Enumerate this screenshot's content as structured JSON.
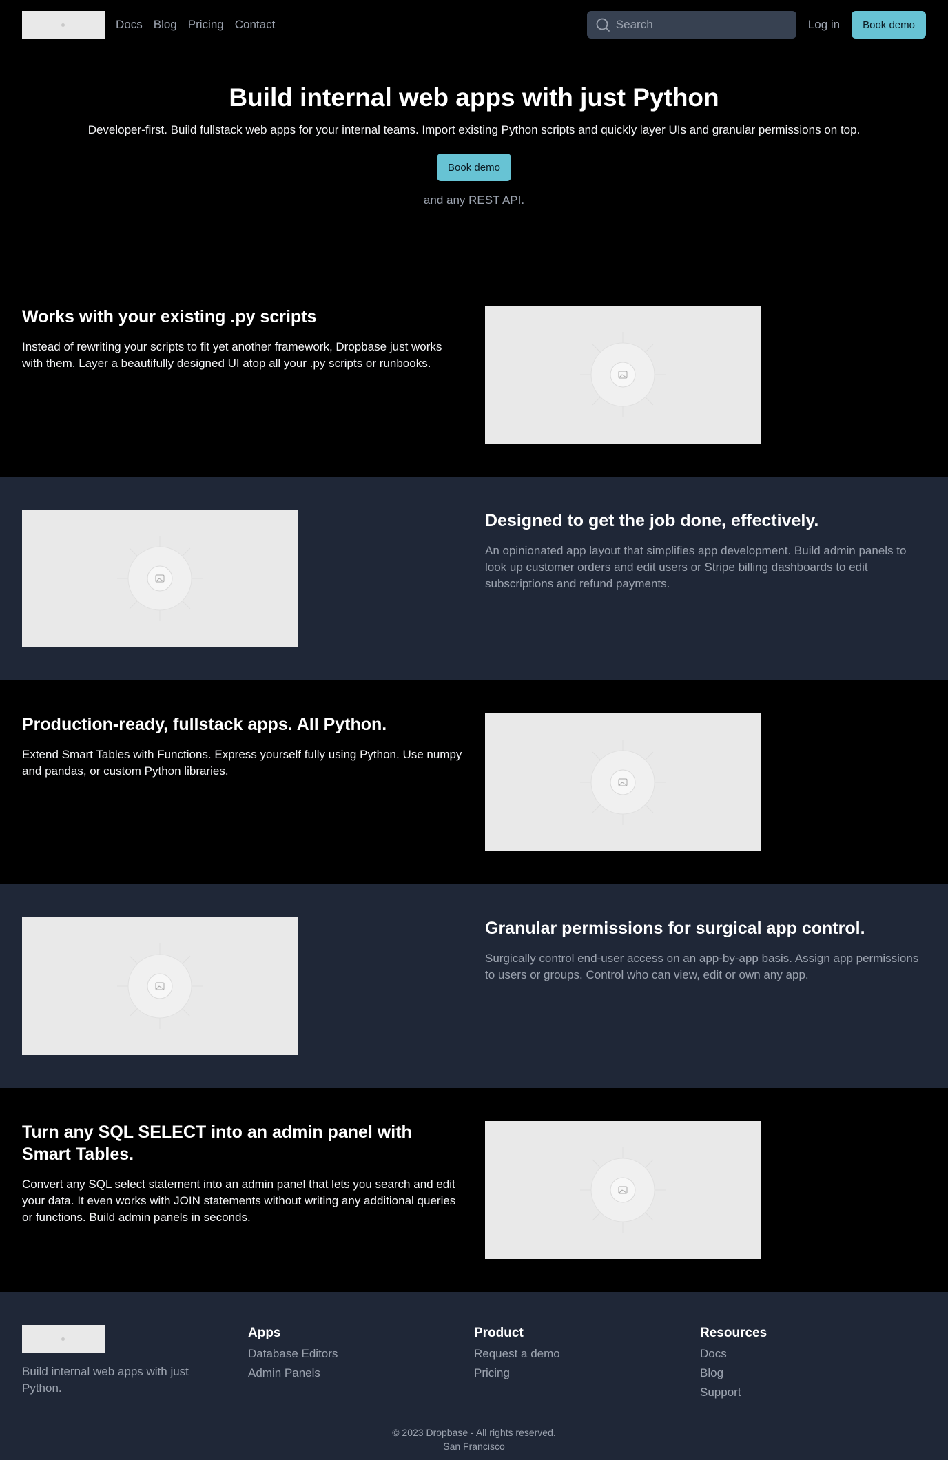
{
  "header": {
    "nav": [
      "Docs",
      "Blog",
      "Pricing",
      "Contact"
    ],
    "search_placeholder": "Search",
    "login_label": "Log in",
    "demo_label": "Book demo"
  },
  "hero": {
    "title": "Build internal web apps with just Python",
    "subtitle": "Developer-first. Build fullstack web apps for your internal teams. Import existing Python scripts and quickly layer UIs and granular permissions on top.",
    "cta": "Book demo",
    "note": "and any REST API."
  },
  "features": [
    {
      "title": "Works with your existing .py scripts",
      "body": "Instead of rewriting your scripts to fit yet another framework, Dropbase just works with them. Layer a beautifully designed UI atop all your .py scripts or runbooks."
    },
    {
      "title": "Designed to get the job done, effectively.",
      "body": "An opinionated app layout that simplifies app development. Build admin panels to look up customer orders and edit users or Stripe billing dashboards to edit subscriptions and refund payments."
    },
    {
      "title": "Production-ready, fullstack apps. All Python.",
      "body": "Extend Smart Tables with Functions. Express yourself fully using Python. Use numpy and pandas, or custom Python libraries."
    },
    {
      "title": "Granular permissions for surgical app control.",
      "body": "Surgically control end-user access on an app-by-app basis. Assign app permissions to users or groups. Control who can view, edit or own any app."
    },
    {
      "title": "Turn any SQL SELECT into an admin panel with Smart Tables.",
      "body": "Convert any SQL select statement into an admin panel that lets you search and edit your data. It even works with JOIN statements without writing any additional queries or functions. Build admin panels in seconds."
    }
  ],
  "footer": {
    "tagline": "Build internal web apps with just Python.",
    "columns": [
      {
        "title": "Apps",
        "links": [
          "Database Editors",
          "Admin Panels"
        ]
      },
      {
        "title": "Product",
        "links": [
          "Request a demo",
          "Pricing"
        ]
      },
      {
        "title": "Resources",
        "links": [
          "Docs",
          "Blog",
          "Support"
        ]
      }
    ],
    "copyright": "© 2023 Dropbase - All rights reserved.",
    "location": "San Francisco"
  },
  "colors": {
    "accent": "#67c3d4",
    "dark_bg": "#000000",
    "slate_bg": "#1f2737",
    "muted_text": "#9ca3af"
  },
  "icons": [
    "search-icon",
    "image-placeholder-icon"
  ]
}
